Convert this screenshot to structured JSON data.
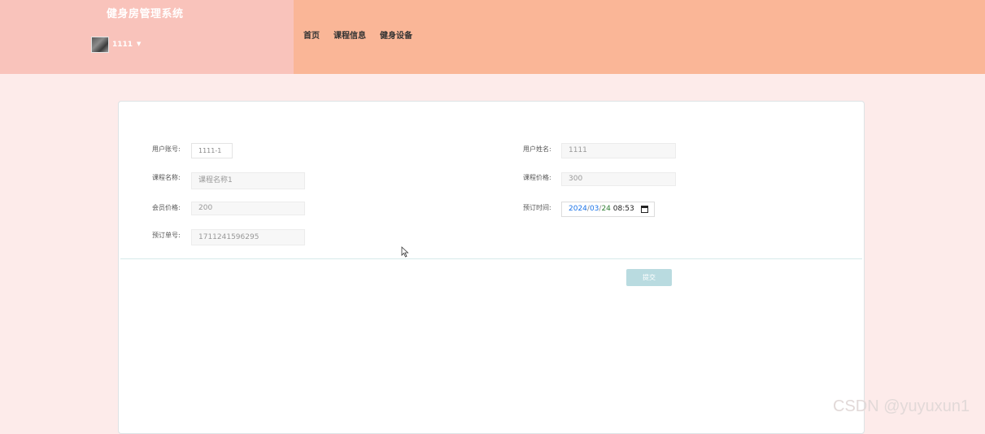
{
  "app": {
    "title": "健身房管理系统",
    "user": {
      "name": "1111",
      "caret": "▼"
    }
  },
  "nav": {
    "items": [
      {
        "label": "首页"
      },
      {
        "label": "课程信息"
      },
      {
        "label": "健身设备"
      }
    ]
  },
  "form": {
    "account": {
      "label": "用户账号:",
      "value": "1111-1"
    },
    "username": {
      "label": "用户姓名:",
      "value": "1111"
    },
    "course_name": {
      "label": "课程名称:",
      "value": "课程名称1"
    },
    "course_price": {
      "label": "课程价格:",
      "value": "300"
    },
    "member_price": {
      "label": "会员价格:",
      "value": "200"
    },
    "booking_time": {
      "label": "预订时间:",
      "year": "2024",
      "month": "03",
      "day": "24",
      "time": "08:53",
      "separator": "/"
    },
    "order_no": {
      "label": "预订单号:",
      "value": "1711241596295"
    },
    "submit_label": "提交"
  },
  "watermark": "CSDN @yuyuxun1",
  "colors": {
    "page_bg": "#fdebea",
    "header_left": "#f9c3bb",
    "header_right": "#fab697",
    "submit": "#b9dbe0"
  }
}
